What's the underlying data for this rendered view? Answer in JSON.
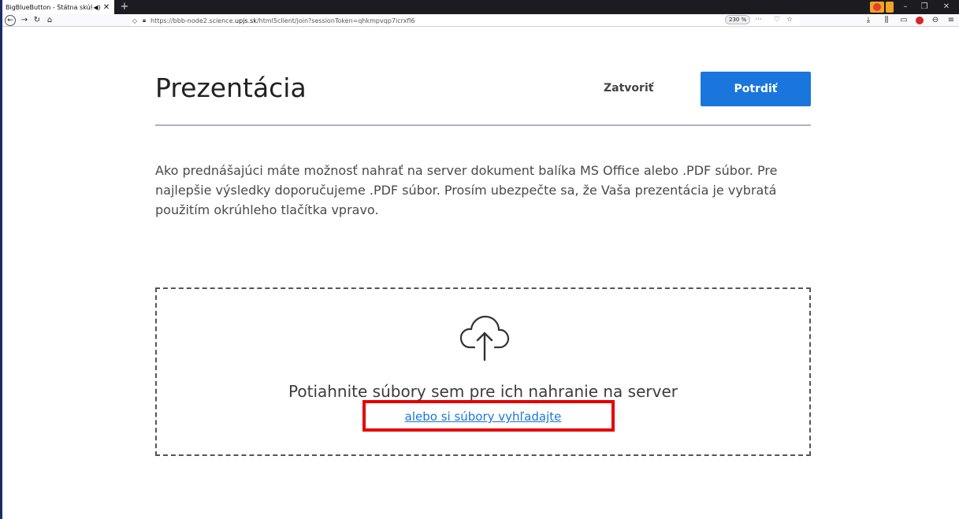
{
  "browser": {
    "tab_title": "BigBlueButton - Štátna skúška -",
    "tab_audio_icon": "speaker-icon",
    "tab_close": "✕",
    "new_tab": "+",
    "url_prefix": "https://bbb-node2.science.",
    "url_domain": "upjs.sk",
    "url_path": "/html5client/join?sessionToken=qhkmpvqp7icrxfl6",
    "zoom": "230 %",
    "url_more": "···",
    "titlebar_min": "–",
    "titlebar_restore": "❐",
    "titlebar_close": "✕"
  },
  "modal": {
    "title": "Prezentácia",
    "close_label": "Zatvoriť",
    "confirm_label": "Potrdiť",
    "description": "Ako prednášajúci máte možnosť nahrať na server dokument balíka MS Office alebo .PDF súbor. Pre najlepšie výsledky doporučujeme .PDF súbor. Prosím ubezpečte sa, že Vaša prezentácia je vybratá použitím okrúhleho tlačítka vpravo.",
    "dropzone": {
      "text": "Potiahnite súbory sem pre ich nahranie na server",
      "browse_link": "alebo si súbory vyhľadajte",
      "icon": "cloud-upload-icon"
    }
  },
  "colors": {
    "primary": "#1a76dc",
    "highlight": "#e50000",
    "tabbar": "#1c1b22"
  }
}
